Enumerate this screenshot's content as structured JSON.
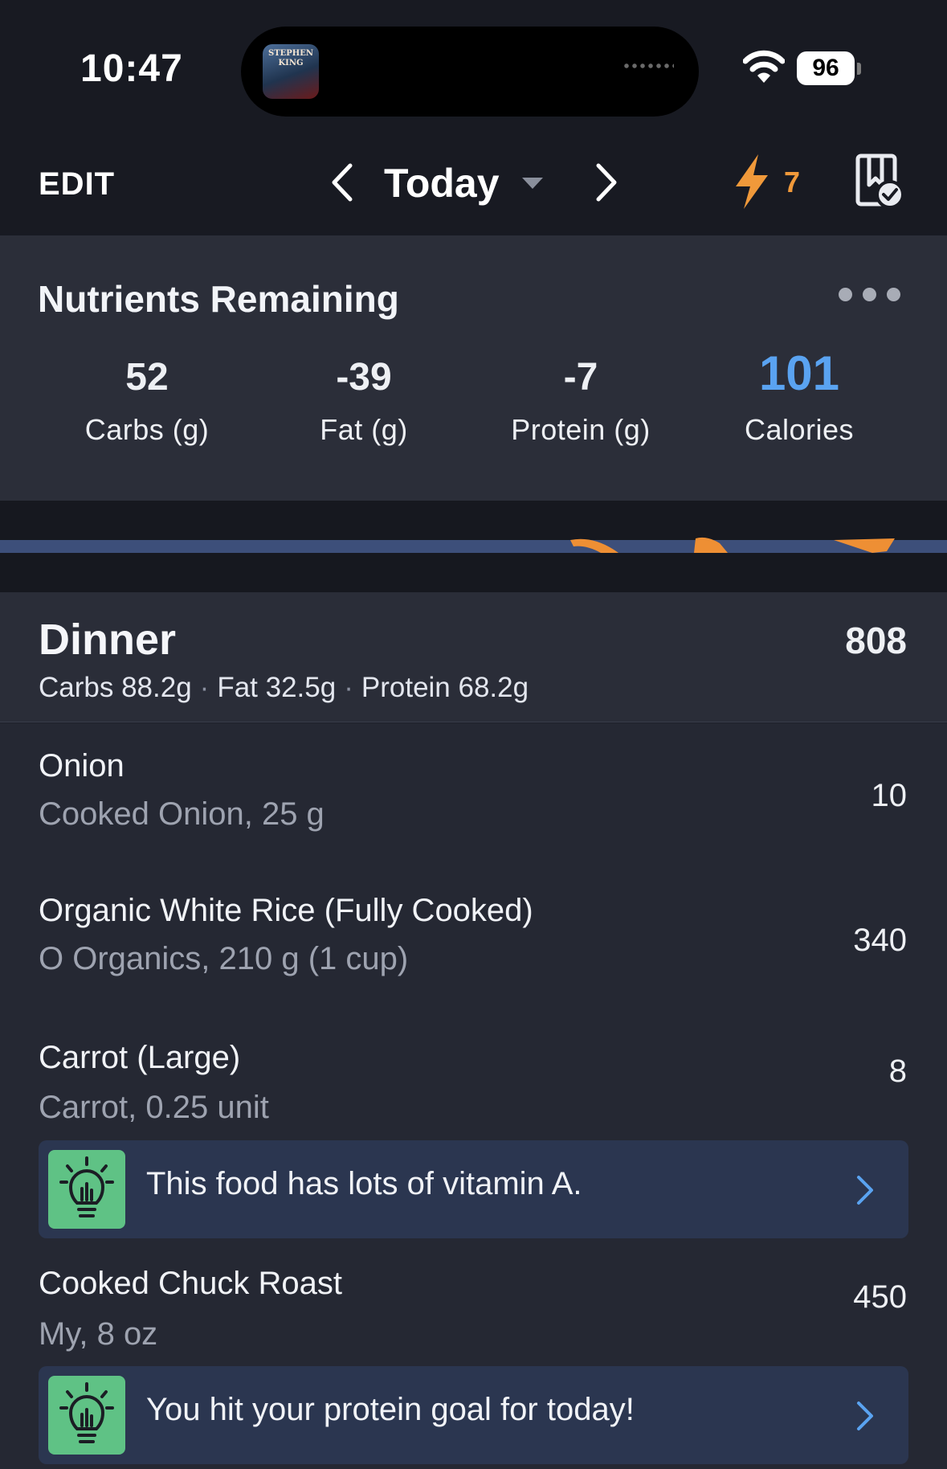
{
  "status_bar": {
    "time": "10:47",
    "now_playing_art_lines": [
      "STEPHEN",
      "KING"
    ],
    "battery": "96"
  },
  "nav": {
    "edit_label": "EDIT",
    "title": "Today",
    "streak_count": "7",
    "icons": [
      "chevron-left-icon",
      "dropdown-caret-icon",
      "chevron-right-icon",
      "lightning-bolt-icon",
      "plan-check-icon"
    ]
  },
  "nutrients": {
    "title": "Nutrients Remaining",
    "items": [
      {
        "value": "52",
        "label": "Carbs (g)"
      },
      {
        "value": "-39",
        "label": "Fat (g)"
      },
      {
        "value": "-7",
        "label": "Protein (g)"
      },
      {
        "value": "101",
        "label": "Calories"
      }
    ]
  },
  "meal": {
    "title": "Dinner",
    "calories": "808",
    "macros": {
      "carbs": "Carbs 88.2g",
      "fat": "Fat 32.5g",
      "protein": "Protein 68.2g"
    },
    "foods": [
      {
        "name": "Onion",
        "desc": "Cooked Onion, 25 g",
        "calories": "10"
      },
      {
        "name": "Organic White Rice (Fully Cooked)",
        "desc": "O Organics, 210 g (1 cup)",
        "calories": "340"
      },
      {
        "name": "Carrot (Large)",
        "desc": "Carrot, 0.25 unit",
        "calories": "8"
      },
      {
        "name": "Cooked Chuck Roast",
        "desc": "My, 8 oz",
        "calories": "450"
      }
    ],
    "tips": [
      {
        "text": "This food has lots of vitamin A."
      },
      {
        "text": "You hit your protein goal for today!"
      }
    ]
  },
  "colors": {
    "accent_blue": "#5aa3f1",
    "streak_orange": "#f0993a",
    "tip_green": "#5fc285",
    "tip_background": "#2b3650"
  }
}
